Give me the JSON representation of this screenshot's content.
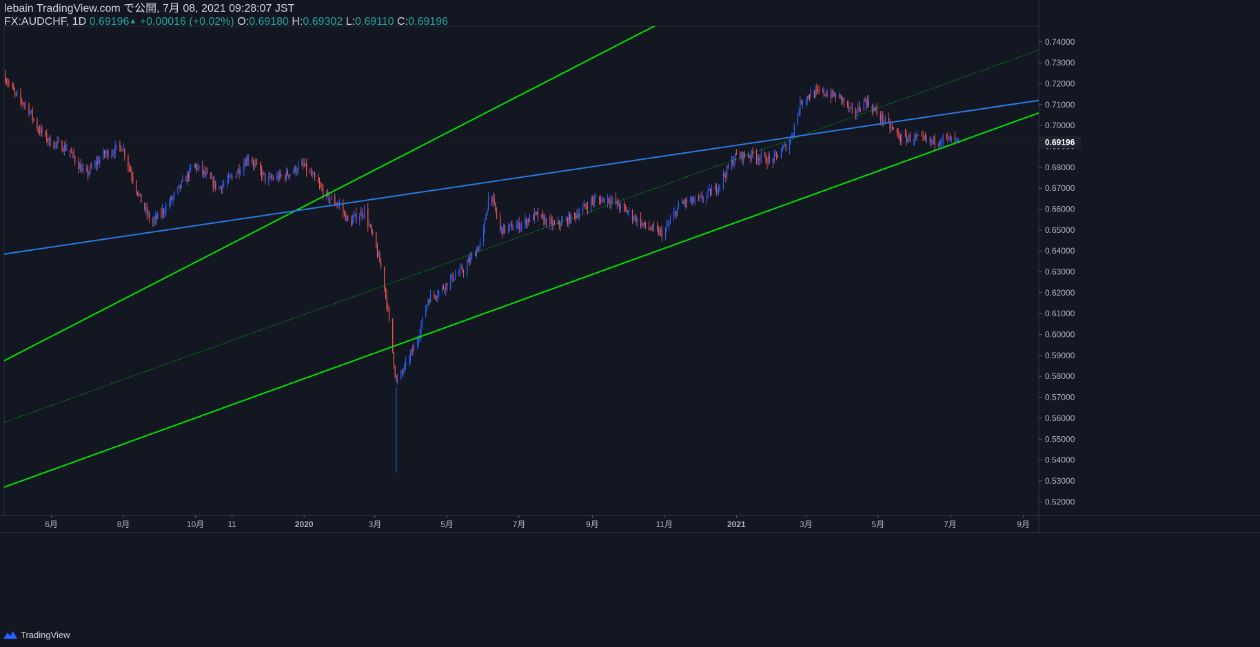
{
  "header": {
    "publish_line": "lebain TradingView.com で公開, 7月 08, 2021 09:28:07 JST",
    "symbol": "FX:AUDCHF, 1D",
    "last": "0.69196",
    "change": "+0.00016 (+0.02%)",
    "open_label": "O:",
    "open": "0.69180",
    "high_label": "H:",
    "high": "0.69302",
    "low_label": "L:",
    "low": "0.69110",
    "close_label": "C:",
    "close": "0.69196"
  },
  "footer": {
    "brand": "TradingView",
    "logo_icon": "tradingview-logo-icon"
  },
  "colors": {
    "background": "#131722",
    "up": "#2962ff",
    "down": "#ef5350",
    "channel": "#00e600",
    "trendline": "#2a7be4",
    "price_label_bg": "#1e222d"
  },
  "chart_data": {
    "type": "candlestick",
    "symbol": "AUDCHF",
    "timeframe": "1D",
    "x_ticks": [
      "6月",
      "8月",
      "10月",
      "11",
      "2020",
      "3月",
      "5月",
      "7月",
      "9月",
      "11月",
      "2021",
      "3月",
      "5月",
      "7月",
      "9月"
    ],
    "x_tick_dates": [
      "2019-06-01",
      "2019-08-01",
      "2019-10-01",
      "2019-11-01",
      "2020-01-01",
      "2020-03-01",
      "2020-05-01",
      "2020-07-01",
      "2020-09-01",
      "2020-11-01",
      "2021-01-01",
      "2021-03-01",
      "2021-05-01",
      "2021-07-01",
      "2021-09-01"
    ],
    "y_ticks": [
      "0.52000",
      "0.53000",
      "0.54000",
      "0.55000",
      "0.56000",
      "0.57000",
      "0.58000",
      "0.59000",
      "0.60000",
      "0.61000",
      "0.62000",
      "0.63000",
      "0.64000",
      "0.65000",
      "0.66000",
      "0.67000",
      "0.68000",
      "0.69000",
      "0.70000",
      "0.71000",
      "0.72000",
      "0.73000",
      "0.74000"
    ],
    "ylim": [
      0.5135,
      0.7475
    ],
    "xlim": [
      "2019-04-22",
      "2021-09-14"
    ],
    "last_price_label": "0.69196",
    "last_price": 0.69196,
    "price_path": [
      [
        "2019-04-22",
        0.724
      ],
      [
        "2019-05-02",
        0.714
      ],
      [
        "2019-05-12",
        0.709
      ],
      [
        "2019-05-20",
        0.699
      ],
      [
        "2019-05-31",
        0.692
      ],
      [
        "2019-06-15",
        0.689
      ],
      [
        "2019-06-30",
        0.676
      ],
      [
        "2019-07-15",
        0.686
      ],
      [
        "2019-07-31",
        0.69
      ],
      [
        "2019-08-15",
        0.665
      ],
      [
        "2019-08-25",
        0.653
      ],
      [
        "2019-09-05",
        0.66
      ],
      [
        "2019-09-15",
        0.668
      ],
      [
        "2019-09-30",
        0.681
      ],
      [
        "2019-10-10",
        0.676
      ],
      [
        "2019-10-20",
        0.67
      ],
      [
        "2019-11-01",
        0.675
      ],
      [
        "2019-11-15",
        0.685
      ],
      [
        "2019-11-30",
        0.674
      ],
      [
        "2019-12-15",
        0.676
      ],
      [
        "2019-12-31",
        0.681
      ],
      [
        "2020-01-10",
        0.674
      ],
      [
        "2020-01-20",
        0.666
      ],
      [
        "2020-01-31",
        0.662
      ],
      [
        "2020-02-08",
        0.653
      ],
      [
        "2020-02-15",
        0.657
      ],
      [
        "2020-02-21",
        0.659
      ],
      [
        "2020-03-01",
        0.643
      ],
      [
        "2020-03-08",
        0.628
      ],
      [
        "2020-03-12",
        0.611
      ],
      [
        "2020-03-19",
        0.577
      ],
      [
        "2020-03-26",
        0.584
      ],
      [
        "2020-04-05",
        0.596
      ],
      [
        "2020-04-15",
        0.617
      ],
      [
        "2020-04-25",
        0.621
      ],
      [
        "2020-05-05",
        0.627
      ],
      [
        "2020-05-15",
        0.631
      ],
      [
        "2020-05-31",
        0.645
      ],
      [
        "2020-06-06",
        0.67
      ],
      [
        "2020-06-15",
        0.65
      ],
      [
        "2020-06-30",
        0.652
      ],
      [
        "2020-07-15",
        0.657
      ],
      [
        "2020-07-31",
        0.652
      ],
      [
        "2020-08-15",
        0.656
      ],
      [
        "2020-09-01",
        0.664
      ],
      [
        "2020-09-15",
        0.665
      ],
      [
        "2020-09-30",
        0.659
      ],
      [
        "2020-10-15",
        0.652
      ],
      [
        "2020-10-31",
        0.648
      ],
      [
        "2020-11-15",
        0.663
      ],
      [
        "2020-11-30",
        0.664
      ],
      [
        "2020-12-15",
        0.67
      ],
      [
        "2020-12-31",
        0.685
      ],
      [
        "2021-01-15",
        0.686
      ],
      [
        "2021-01-31",
        0.683
      ],
      [
        "2021-02-15",
        0.692
      ],
      [
        "2021-02-25",
        0.712
      ],
      [
        "2021-03-05",
        0.715
      ],
      [
        "2021-03-15",
        0.716
      ],
      [
        "2021-03-31",
        0.713
      ],
      [
        "2021-04-10",
        0.705
      ],
      [
        "2021-04-20",
        0.712
      ],
      [
        "2021-04-30",
        0.706
      ],
      [
        "2021-05-10",
        0.7
      ],
      [
        "2021-05-20",
        0.694
      ],
      [
        "2021-05-31",
        0.694
      ],
      [
        "2021-06-15",
        0.692
      ],
      [
        "2021-06-25",
        0.694
      ],
      [
        "2021-07-08",
        0.692
      ]
    ],
    "lines": [
      {
        "style": "solid",
        "color": "#00e600",
        "from": [
          "2019-04-22",
          0.5875
        ],
        "to": [
          "2020-11-01",
          0.75
        ]
      },
      {
        "style": "solid",
        "color": "#00e600",
        "from": [
          "2019-04-22",
          0.527
        ],
        "to": [
          "2021-09-14",
          0.706
        ]
      },
      {
        "style": "dotted",
        "color": "#00e600",
        "from": [
          "2019-04-22",
          0.558
        ],
        "to": [
          "2021-09-14",
          0.736
        ]
      },
      {
        "style": "solid",
        "color": "#2a7be4",
        "from": [
          "2019-04-22",
          0.6385
        ],
        "to": [
          "2021-09-14",
          0.712
        ]
      }
    ]
  }
}
